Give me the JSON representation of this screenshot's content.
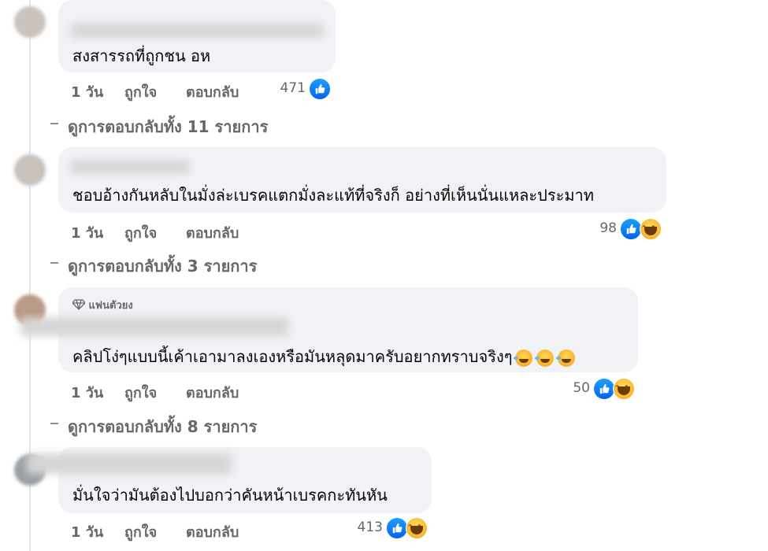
{
  "comments": [
    {
      "text": "สงสารรถที่ถูกชน อห",
      "actions": {
        "time": "1 วัน",
        "like": "ถูกใจ",
        "reply": "ตอบกลับ"
      },
      "reaction_count": "471",
      "reactions": [
        "like-icon"
      ],
      "replies_link": "ดูการตอบกลับทั้ง 11 รายการ"
    },
    {
      "text": "ชอบอ้างกันหลับในมั่งล่ะเบรคแตกมั่งละแท้ที่จริงก็ อย่างที่เห็นนั่นแหละประมาท",
      "actions": {
        "time": "1 วัน",
        "like": "ถูกใจ",
        "reply": "ตอบกลับ"
      },
      "reaction_count": "98",
      "reactions": [
        "like-icon",
        "haha-icon"
      ],
      "replies_link": "ดูการตอบกลับทั้ง 3 รายการ"
    },
    {
      "badge": "แฟนตัวยง",
      "text": "คลิปโง่ๆแบบนี้เค้าเอามาลงเองหรือมันหลุดมาครับอยากทราบจริงๆ",
      "trailing_emojis": [
        "rofl-emoji",
        "rofl-emoji",
        "rofl-emoji"
      ],
      "actions": {
        "time": "1 วัน",
        "like": "ถูกใจ",
        "reply": "ตอบกลับ"
      },
      "reaction_count": "50",
      "reactions": [
        "like-icon",
        "haha-icon"
      ],
      "replies_link": "ดูการตอบกลับทั้ง 8 รายการ"
    },
    {
      "text": "มั่นใจว่ามันต้องไปบอกว่าคันหน้าเบรคกะทันหัน",
      "actions": {
        "time": "1 วัน",
        "like": "ถูกใจ",
        "reply": "ตอบกลับ"
      },
      "reaction_count": "413",
      "reactions": [
        "like-icon",
        "haha-icon"
      ]
    }
  ]
}
